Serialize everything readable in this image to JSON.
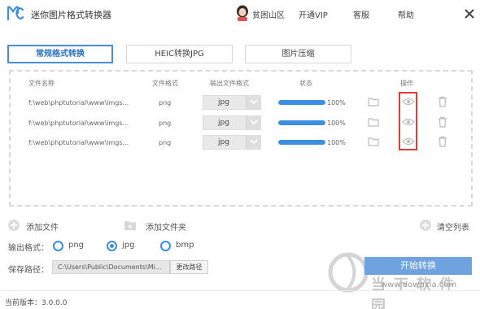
{
  "app": {
    "title": "迷你图片格式转换器",
    "logo_icon": "mc-logo-icon"
  },
  "topbar": {
    "user_name": "贫困山区",
    "vip_label": "开通VIP",
    "service_label": "客服",
    "help_label": "帮助",
    "close_icon": "close-icon"
  },
  "tabs": [
    {
      "label": "常规格式转换",
      "active": true
    },
    {
      "label": "HEIC转换JPG",
      "active": false
    },
    {
      "label": "图片压缩",
      "active": false
    }
  ],
  "table": {
    "headers": {
      "file_name": "文件名称",
      "file_format": "文件格式",
      "output_format": "输出文件格式",
      "status": "状态",
      "actions": "操作"
    },
    "rows": [
      {
        "file_name": "f:\\web\\phptutorial\\www\\imgs...",
        "format": "png",
        "output": "jpg",
        "progress": 100,
        "progress_text": "100%"
      },
      {
        "file_name": "f:\\web\\phptutorial\\www\\imgs...",
        "format": "png",
        "output": "jpg",
        "progress": 100,
        "progress_text": "100%"
      },
      {
        "file_name": "f:\\web\\phptutorial\\www\\imgs...",
        "format": "png",
        "output": "jpg",
        "progress": 100,
        "progress_text": "100%"
      }
    ]
  },
  "actions": {
    "add_file": "添加文件",
    "add_folder": "添加文件夹",
    "clear_list": "清空列表"
  },
  "output_format": {
    "label": "输出格式：",
    "options": [
      "png",
      "jpg",
      "bmp"
    ],
    "selected": "jpg"
  },
  "save_path": {
    "label": "保存路径：",
    "value": "C:\\Users\\Public\\Documents\\Mi...",
    "change_label": "更改路径"
  },
  "start_button": "开始转换",
  "version": "当前版本：3.0.0.0",
  "watermark": {
    "big_text": "当下软件园",
    "url": "www.downxia.com"
  },
  "colors": {
    "accent": "#3d8ee0",
    "highlight_box": "#e03a3a",
    "start_button": "#6ea3df"
  }
}
